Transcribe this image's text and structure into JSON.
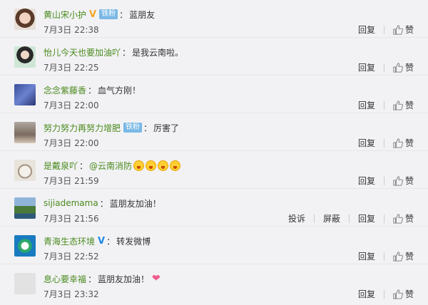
{
  "colors": {
    "username": "#4a8a1c",
    "fans_badge": "#7ab8e5",
    "v_orange": "#f5a623",
    "v_blue": "#1e88e5"
  },
  "actions": {
    "report": "投诉",
    "block": "屏蔽",
    "reply": "回复",
    "like": "赞"
  },
  "comments": [
    {
      "user": "黄山宋小护",
      "badge": "V",
      "fans": "铁粉",
      "text": "蓝朋友",
      "time": "7月3日 22:38"
    },
    {
      "user": "怡儿今天也要加油吖",
      "text": "是我云南啦。",
      "time": "7月3日 22:25"
    },
    {
      "user": "念念紫藤香",
      "text": "血气方刚！",
      "time": "7月3日 22:00"
    },
    {
      "user": "努力努力再努力增肥",
      "fans": "铁粉",
      "text": "厉害了",
      "time": "7月3日 22:00"
    },
    {
      "user": "是戴泉吖",
      "mention": "@云南消防",
      "time": "7月3日 21:59"
    },
    {
      "user": "sijiademama",
      "text": "蓝朋友加油！",
      "time": "7月3日 21:56"
    },
    {
      "user": "青海生态环境",
      "badge": "V",
      "text": "转发微博",
      "time": "7月3日 22:52"
    },
    {
      "user": "息心要幸福",
      "text": "蓝朋友加油！",
      "time": "7月3日 23:32"
    }
  ]
}
